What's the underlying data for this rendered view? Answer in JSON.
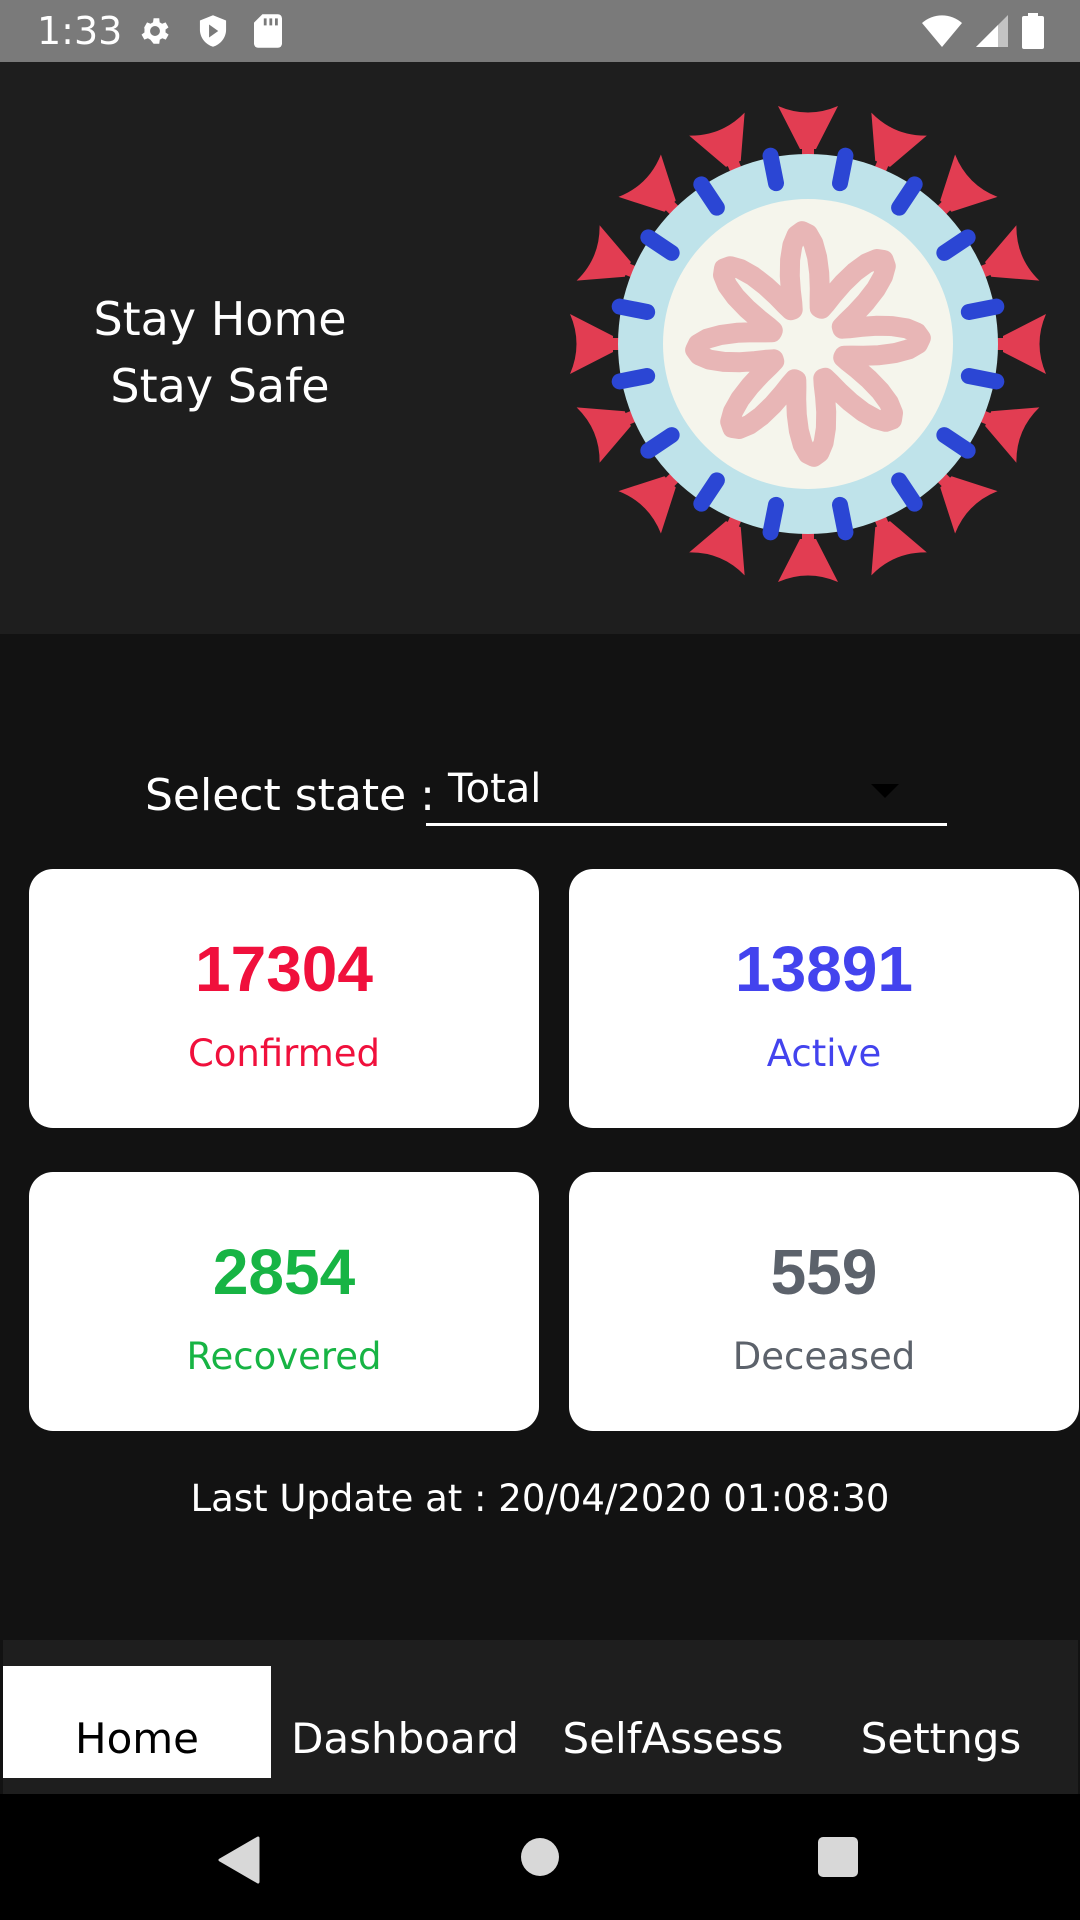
{
  "status_bar": {
    "time": "1:33",
    "icons": [
      "gear-icon",
      "shield-icon",
      "sd-card-icon",
      "wifi-icon",
      "signal-icon",
      "battery-icon"
    ]
  },
  "banner": {
    "line1": "Stay Home",
    "line2": "Stay Safe",
    "image": "virus-illustration"
  },
  "selector": {
    "label": "Select state :",
    "value": "Total"
  },
  "stats": [
    {
      "value": "17304",
      "label": "Confirmed",
      "color": "#f0103c"
    },
    {
      "value": "13891",
      "label": "Active",
      "color": "#4343ee"
    },
    {
      "value": "2854",
      "label": "Recovered",
      "color": "#17b444"
    },
    {
      "value": "559",
      "label": "Deceased",
      "color": "#5c626b"
    }
  ],
  "last_update": "Last Update at : 20/04/2020 01:08:30",
  "bottom_nav": {
    "tabs": [
      {
        "label": "Home",
        "active": true
      },
      {
        "label": "Dashboard",
        "active": false
      },
      {
        "label": "SelfAssess",
        "active": false
      },
      {
        "label": "Settngs",
        "active": false
      }
    ]
  },
  "colors": {
    "banner_bg": "#1e1e1e",
    "page_bg": "#121212",
    "virus_spike": "#e23d52",
    "virus_ring": "#bfe3ea",
    "virus_dots": "#2b46d4",
    "virus_core": "#f5f5ec",
    "virus_inner": "#e8b6b6"
  }
}
